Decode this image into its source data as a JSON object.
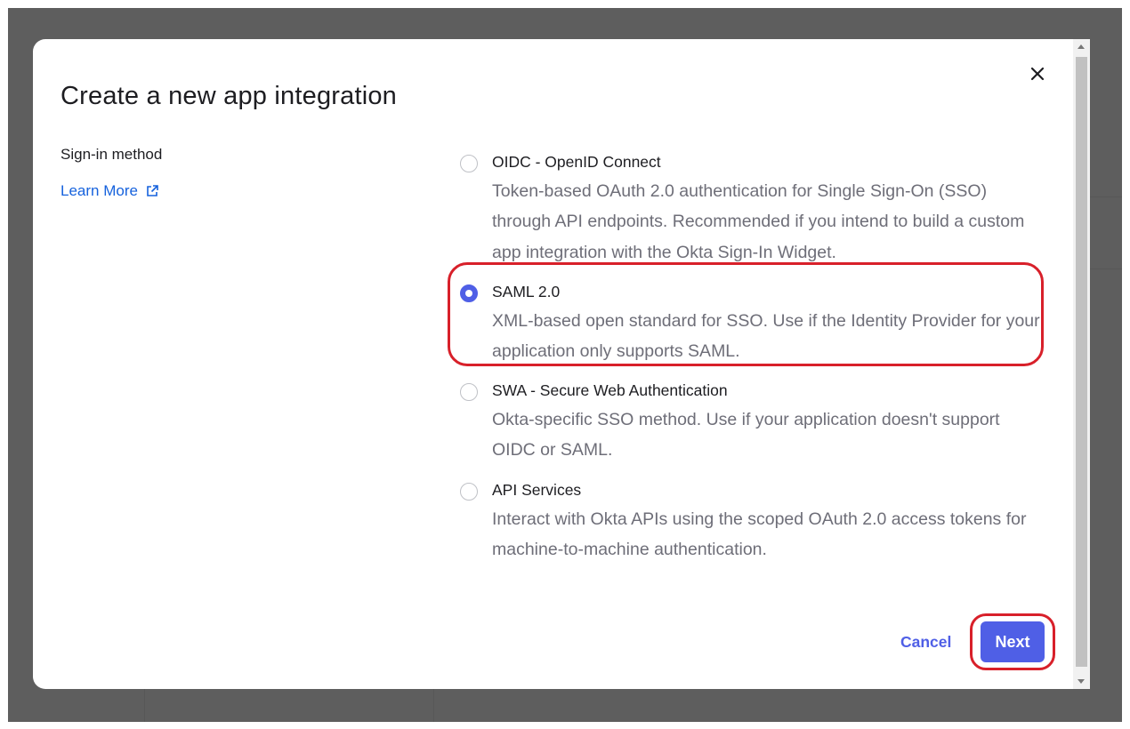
{
  "dialog": {
    "title": "Create a new app integration",
    "close_icon": "close-icon"
  },
  "side": {
    "label": "Sign-in method",
    "learn_more": "Learn More",
    "learn_icon": "external-link-icon"
  },
  "options": [
    {
      "label": "OIDC - OpenID Connect",
      "description": "Token-based OAuth 2.0 authentication for Single Sign-On (SSO) through API endpoints. Recommended if you intend to build a custom app integration with the Okta Sign-In Widget.",
      "selected": false
    },
    {
      "label": "SAML 2.0",
      "description": "XML-based open standard for SSO. Use if the Identity Provider for your application only supports SAML.",
      "selected": true
    },
    {
      "label": "SWA - Secure Web Authentication",
      "description": "Okta-specific SSO method. Use if your application doesn't support OIDC or SAML.",
      "selected": false
    },
    {
      "label": "API Services",
      "description": "Interact with Okta APIs using the scoped OAuth 2.0 access tokens for machine-to-machine authentication.",
      "selected": false
    }
  ],
  "footer": {
    "cancel_label": "Cancel",
    "next_label": "Next"
  },
  "colors": {
    "accent": "#4f5fe6",
    "link": "#1662dd",
    "highlight": "#d8202a"
  }
}
